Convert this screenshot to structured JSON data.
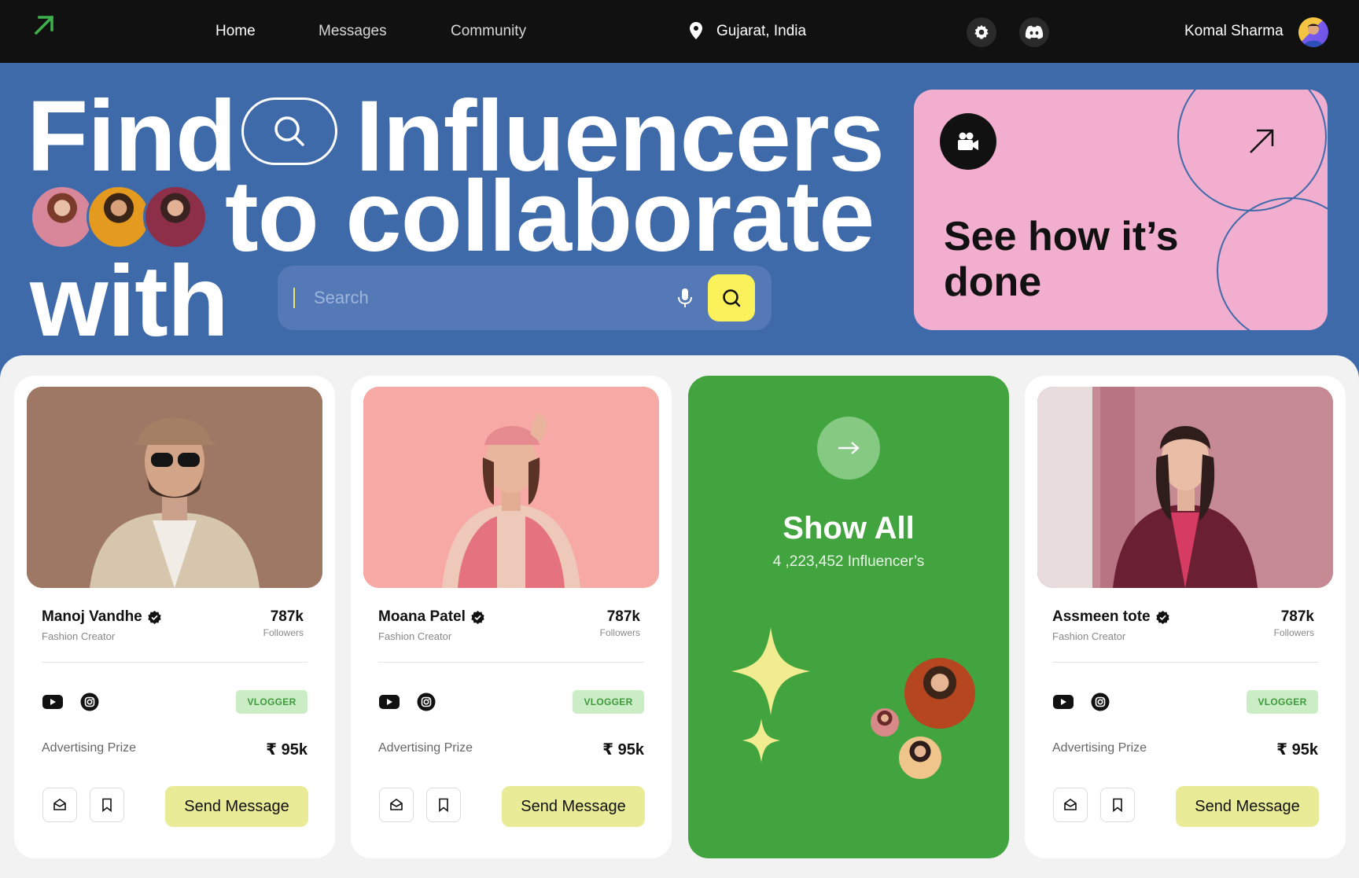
{
  "nav": {
    "links": [
      "Home",
      "Messages",
      "Community"
    ],
    "location": "Gujarat, India",
    "user_name": "Komal Sharma",
    "icons": [
      "arrow-up-right-icon",
      "location-pin-icon",
      "gear-icon",
      "discord-icon",
      "avatar"
    ]
  },
  "hero": {
    "line1_a": "Find",
    "line1_b": "Influencers",
    "line2": "to collaborate",
    "line3": "with",
    "search_placeholder": "Search",
    "search_value": ""
  },
  "promo": {
    "title": "See how it’s done",
    "icons": [
      "video-camera-icon",
      "arrow-up-right-icon"
    ]
  },
  "cards": [
    {
      "name": "Manoj Vandhe",
      "role": "Fashion Creator",
      "followers": "787k",
      "followers_label": "Followers",
      "tag": "VLOGGER",
      "prize_label": "Advertising Prize",
      "prize": "₹ 95k",
      "button": "Send Message"
    },
    {
      "name": "Moana Patel",
      "role": "Fashion Creator",
      "followers": "787k",
      "followers_label": "Followers",
      "tag": "VLOGGER",
      "prize_label": "Advertising Prize",
      "prize": "₹ 95k",
      "button": "Send Message"
    },
    {
      "name": "Assmeen tote",
      "role": "Fashion Creator",
      "followers": "787k",
      "followers_label": "Followers",
      "tag": "VLOGGER",
      "prize_label": "Advertising Prize",
      "prize": "₹ 95k",
      "button": "Send Message"
    }
  ],
  "show_all": {
    "title": "Show All",
    "count": "4 ,223,452 Influencer’s"
  },
  "colors": {
    "nav_bg": "#111111",
    "hero_bg": "#3f6aaa",
    "promo_bg": "#f1aecf",
    "accent_yellow": "#fbf15b",
    "show_all_bg": "#42a43f",
    "tag_bg": "#cbedc6",
    "send_btn_bg": "#eaeb96"
  }
}
